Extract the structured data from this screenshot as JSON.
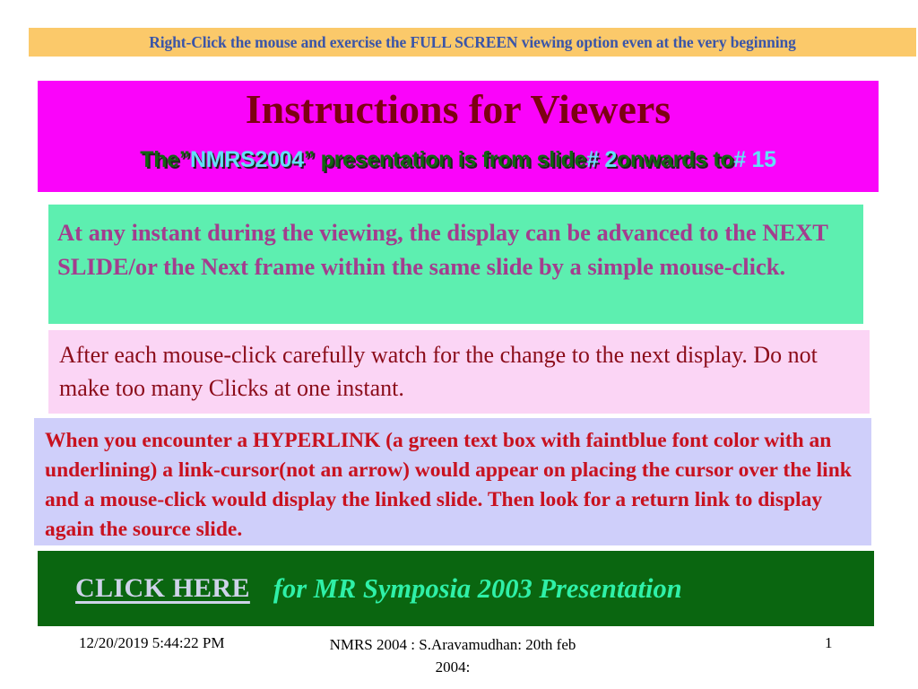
{
  "notice": {
    "text": "Right-Click the mouse and exercise the FULL SCREEN viewing option even at the very beginning",
    "bg_color": "#fbc96a",
    "text_color": "#3a55a8"
  },
  "title_block": {
    "bg_color": "#fa04fa",
    "heading": "Instructions for Viewers",
    "heading_color": "#7d0112",
    "subtitle_parts": {
      "p1": "The”",
      "p2": "NMRS2004",
      "p3": "” presentation is from slide",
      "p4": "# 2",
      "p5": "onwards to",
      "p6": "# 15"
    },
    "subtitle_green": "#116611",
    "subtitle_cyan": "#63e0f5"
  },
  "mint_box": {
    "bg_color": "#5defb0",
    "text_color": "#a33d8e",
    "text": "At any instant during the viewing, the display can be advanced to the NEXT SLIDE/or the Next frame within the same slide by a simple mouse-click."
  },
  "pink_box": {
    "bg_color": "#fbd5f5",
    "text_color": "#8b0c1a",
    "text": "After each mouse-click carefully watch for the change to the next display. Do not make too many Clicks at one instant."
  },
  "lavender_box": {
    "bg_color": "#cfcffa",
    "text_color": "#c8121f",
    "text": "When you encounter a HYPERLINK (a green text box with faintblue font color with an underlining) a link-cursor(not an arrow) would appear on placing the cursor over the link and a mouse-click would display the linked slide. Then look for a return link to display again the source slide."
  },
  "link_box": {
    "bg_color": "#0a6610",
    "click_here_label": "CLICK HERE",
    "click_here_color": "#cfd3ea",
    "caption": "for MR Symposia 2003 Presentation",
    "caption_color": "#2ff0a8"
  },
  "footer": {
    "date": "12/20/2019 5:44:22 PM",
    "center": "NMRS 2004 : S.Aravamudhan: 20th feb 2004:",
    "page_number": "1"
  }
}
